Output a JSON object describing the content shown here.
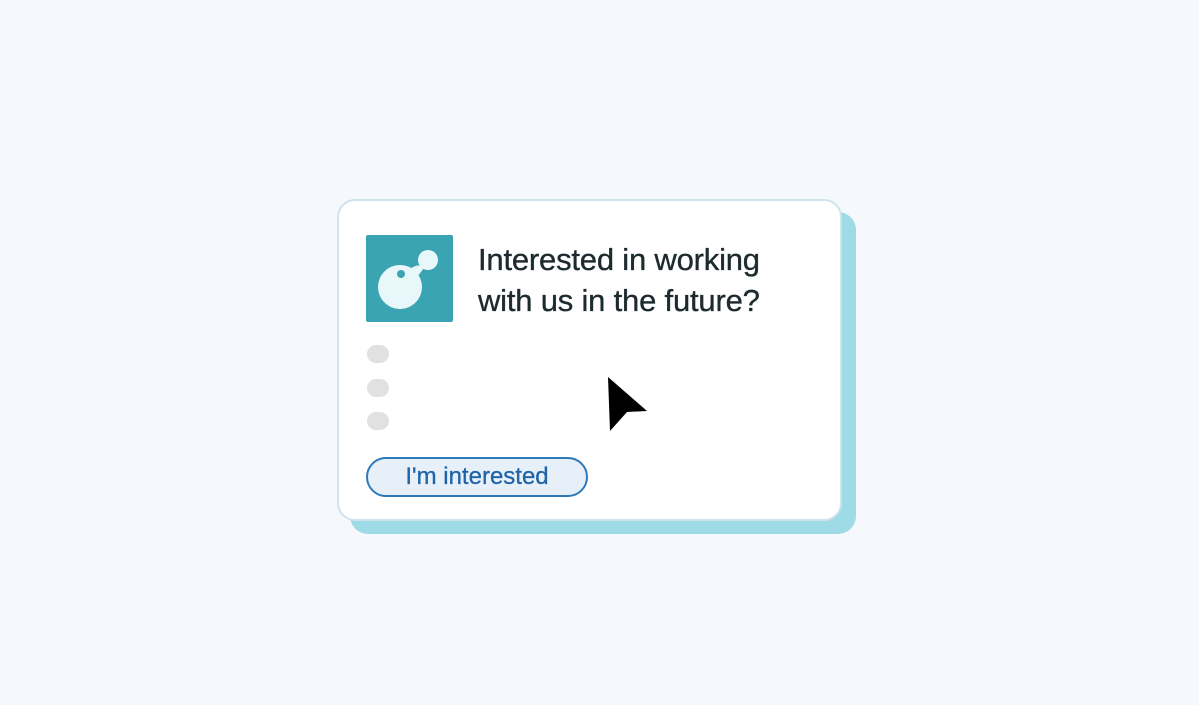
{
  "card": {
    "headline": "Interested in working with us in the future?",
    "button_label": "I'm interested"
  },
  "icons": {
    "logo": "company-logo-icon",
    "cursor": "mouse-pointer-icon"
  },
  "colors": {
    "page_background": "#f5f9fd",
    "card_background": "#ffffff",
    "card_shadow": "#9edbe6",
    "logo_background": "#3ba4b2",
    "logo_mark": "#e8f8fa",
    "headline_text": "#1d2b2e",
    "button_border": "#2e79b7",
    "button_background": "#e7f0f8",
    "button_text": "#1f64a8",
    "placeholder_dots": "#e1e1e1"
  }
}
